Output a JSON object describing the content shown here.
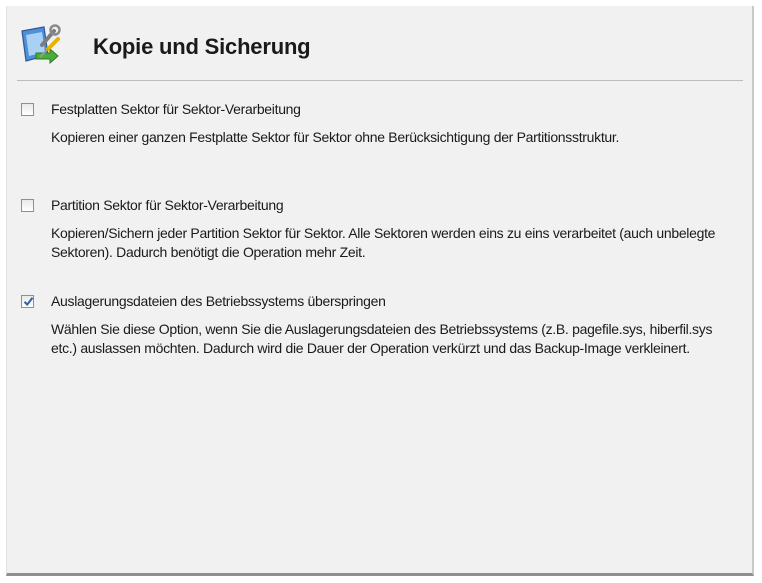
{
  "header": {
    "title": "Kopie und Sicherung",
    "icon": "backup-tools-icon"
  },
  "options": [
    {
      "label": "Festplatten Sektor für Sektor-Verarbeitung",
      "checked": false,
      "description": "Kopieren einer ganzen Festplatte Sektor für Sektor ohne Berücksichtigung der Partitionsstruktur."
    },
    {
      "label": "Partition Sektor für Sektor-Verarbeitung",
      "checked": false,
      "description": "Kopieren/Sichern jeder Partition Sektor für Sektor. Alle Sektoren werden eins zu eins verarbeitet (auch unbelegte Sektoren). Dadurch benötigt die Operation mehr Zeit."
    },
    {
      "label": "Auslagerungsdateien des Betriebssystems überspringen",
      "checked": true,
      "description": "Wählen Sie diese Option, wenn Sie die Auslagerungsdateien des Betriebssystems (z.B. pagefile.sys, hiberfil.sys etc.) auslassen möchten. Dadurch wird die Dauer der Operation verkürzt und das Backup-Image verkleinert."
    }
  ],
  "colors": {
    "panel_bg": "#f1f1f1",
    "checkmark": "#2f5fa8",
    "text": "#1a1a1a"
  }
}
